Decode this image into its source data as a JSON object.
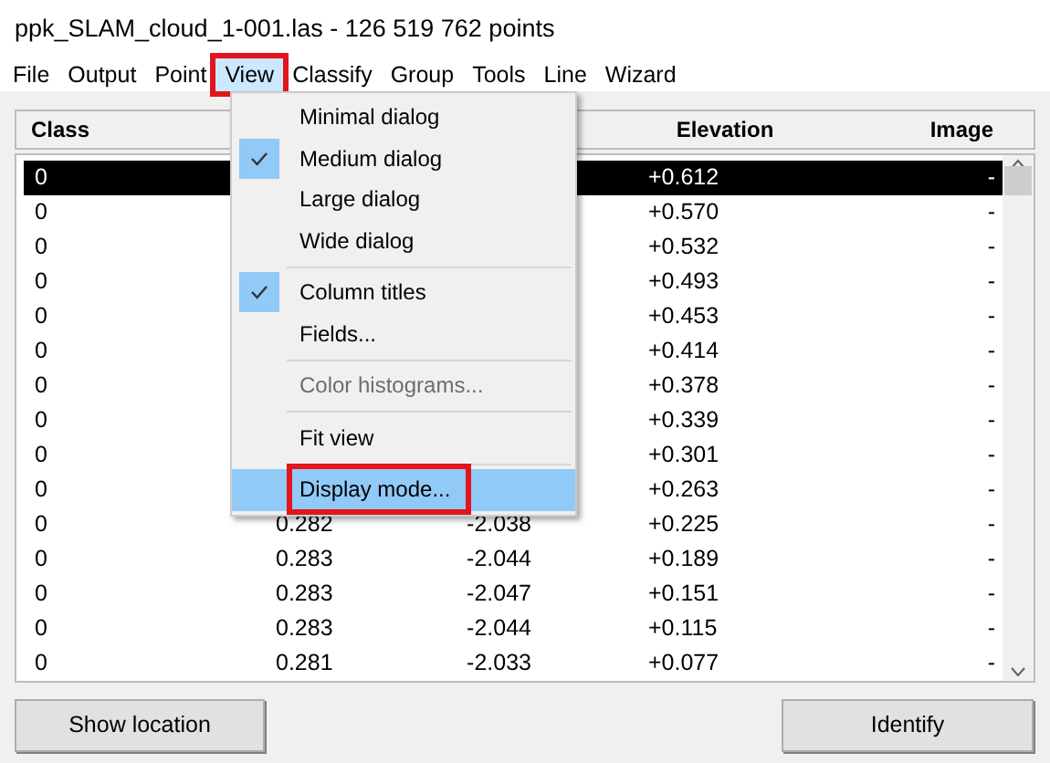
{
  "window": {
    "title": "ppk_SLAM_cloud_1-001.las - 126 519 762 points"
  },
  "menu_bar": [
    {
      "label": "File",
      "selected": false,
      "highlighted": false
    },
    {
      "label": "Output",
      "selected": false,
      "highlighted": false
    },
    {
      "label": "Point",
      "selected": false,
      "highlighted": false
    },
    {
      "label": "View",
      "selected": true,
      "highlighted": true
    },
    {
      "label": "Classify",
      "selected": false,
      "highlighted": false
    },
    {
      "label": "Group",
      "selected": false,
      "highlighted": false
    },
    {
      "label": "Tools",
      "selected": false,
      "highlighted": false
    },
    {
      "label": "Line",
      "selected": false,
      "highlighted": false
    },
    {
      "label": "Wizard",
      "selected": false,
      "highlighted": false
    }
  ],
  "view_menu": [
    {
      "kind": "item",
      "label": "Minimal dialog",
      "checked": false,
      "disabled": false,
      "selected": false,
      "highlighted": false
    },
    {
      "kind": "item",
      "label": "Medium dialog",
      "checked": true,
      "disabled": false,
      "selected": false,
      "highlighted": false
    },
    {
      "kind": "item",
      "label": "Large dialog",
      "checked": false,
      "disabled": false,
      "selected": false,
      "highlighted": false
    },
    {
      "kind": "item",
      "label": "Wide dialog",
      "checked": false,
      "disabled": false,
      "selected": false,
      "highlighted": false
    },
    {
      "kind": "separator"
    },
    {
      "kind": "item",
      "label": "Column titles",
      "checked": true,
      "disabled": false,
      "selected": false,
      "highlighted": false
    },
    {
      "kind": "item",
      "label": "Fields...",
      "checked": false,
      "disabled": false,
      "selected": false,
      "highlighted": false
    },
    {
      "kind": "separator"
    },
    {
      "kind": "item",
      "label": "Color histograms...",
      "checked": false,
      "disabled": true,
      "selected": false,
      "highlighted": false
    },
    {
      "kind": "separator"
    },
    {
      "kind": "item",
      "label": "Fit view",
      "checked": false,
      "disabled": false,
      "selected": false,
      "highlighted": false
    },
    {
      "kind": "separator"
    },
    {
      "kind": "item",
      "label": "Display mode...",
      "checked": false,
      "disabled": false,
      "selected": true,
      "highlighted": true
    }
  ],
  "table": {
    "columns": {
      "class": "Class",
      "elevation": "Elevation",
      "image": "Image"
    },
    "rows": [
      {
        "class": "0",
        "elevation": "+0.612",
        "image": "-",
        "selected": true
      },
      {
        "class": "0",
        "elevation": "+0.570",
        "image": "-",
        "selected": false
      },
      {
        "class": "0",
        "elevation": "+0.532",
        "image": "-",
        "selected": false
      },
      {
        "class": "0",
        "elevation": "+0.493",
        "image": "-",
        "selected": false
      },
      {
        "class": "0",
        "elevation": "+0.453",
        "image": "-",
        "selected": false
      },
      {
        "class": "0",
        "elevation": "+0.414",
        "image": "-",
        "selected": false
      },
      {
        "class": "0",
        "elevation": "+0.378",
        "image": "-",
        "selected": false
      },
      {
        "class": "0",
        "elevation": "+0.339",
        "image": "-",
        "selected": false
      },
      {
        "class": "0",
        "elevation": "+0.301",
        "image": "-",
        "selected": false
      },
      {
        "class": "0",
        "elevation": "+0.263",
        "image": "-",
        "selected": false
      },
      {
        "class": "0",
        "column_2": "0.282",
        "column_3": "-2.038",
        "elevation": "+0.225",
        "image": "-",
        "selected": false
      },
      {
        "class": "0",
        "column_2": "0.283",
        "column_3": "-2.044",
        "elevation": "+0.189",
        "image": "-",
        "selected": false
      },
      {
        "class": "0",
        "column_2": "0.283",
        "column_3": "-2.047",
        "elevation": "+0.151",
        "image": "-",
        "selected": false
      },
      {
        "class": "0",
        "column_2": "0.283",
        "column_3": "-2.044",
        "elevation": "+0.115",
        "image": "-",
        "selected": false
      },
      {
        "class": "0",
        "column_2": "0.281",
        "column_3": "-2.033",
        "elevation": "+0.077",
        "image": "-",
        "selected": false
      }
    ]
  },
  "buttons": [
    {
      "label": "Show location"
    },
    {
      "label": "Identify"
    }
  ]
}
